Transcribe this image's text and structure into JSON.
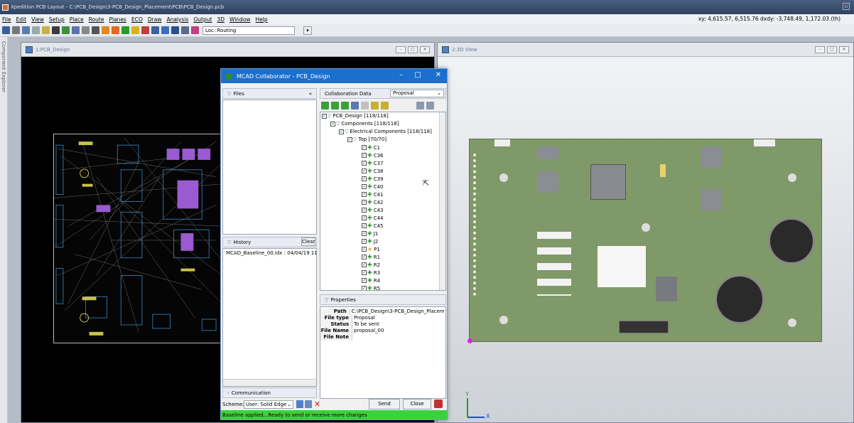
{
  "app": {
    "title": "Xpedition PCB Layout - C:\\PCB_Design\\3-PCB_Design_Placement\\PCB\\PCB_Design.pcb",
    "menu": [
      "File",
      "Edit",
      "View",
      "Setup",
      "Place",
      "Route",
      "Planes",
      "ECO",
      "Draw",
      "Analysis",
      "Output",
      "3D",
      "Window",
      "Help"
    ],
    "coords": "xy: 4,615.57, 6,515.76  dxdy: -3,748.49, 1,172.03 (th)",
    "loc_label": "Loc: Routing"
  },
  "sidebar": {
    "label": "Component Explorer"
  },
  "windows": {
    "pcb_title": "1:PCB_Design",
    "view3d_title": "2:3D View"
  },
  "mcad": {
    "title": "MCAD Collaborator - PCB_Design",
    "files_label": "Files",
    "collapse_glyph": "«",
    "collab_label": "Collaboration Data",
    "collab_dropdown": "Proposal",
    "history_label": "History",
    "clear_label": "Clear",
    "history_item": "MCAD_Baseline_00.idx : 04/04/19 11",
    "communication_label": "Communication",
    "tree": {
      "root": "PCB_Design [118/118]",
      "components": "Components [118/118]",
      "electrical": "Electrical Components [118/118]",
      "top": "Top [70/70]",
      "items": [
        "C1",
        "C36",
        "C37",
        "C38",
        "C39",
        "C40",
        "C41",
        "C42",
        "C43",
        "C44",
        "C45",
        "J1",
        "J2",
        "P1",
        "R1",
        "R2",
        "R3",
        "R4",
        "R5"
      ]
    },
    "properties_label": "Properties",
    "properties": [
      {
        "k": "Path",
        "v": "C:\\PCB_Design\\3-PCB_Design_Placeme..."
      },
      {
        "k": "File type",
        "v": "Proposal"
      },
      {
        "k": "Status",
        "v": "To be sent"
      },
      {
        "k": "File Name",
        "v": "proposal_00"
      },
      {
        "k": "File Note",
        "v": ""
      }
    ],
    "scheme_label": "Scheme:",
    "scheme_value": "User: Solid Edge",
    "send_label": "Send",
    "close_label": "Close",
    "status": "Baseline applied...Ready to send or receive more changes"
  },
  "axes": {
    "y": "Y",
    "x": "X"
  }
}
